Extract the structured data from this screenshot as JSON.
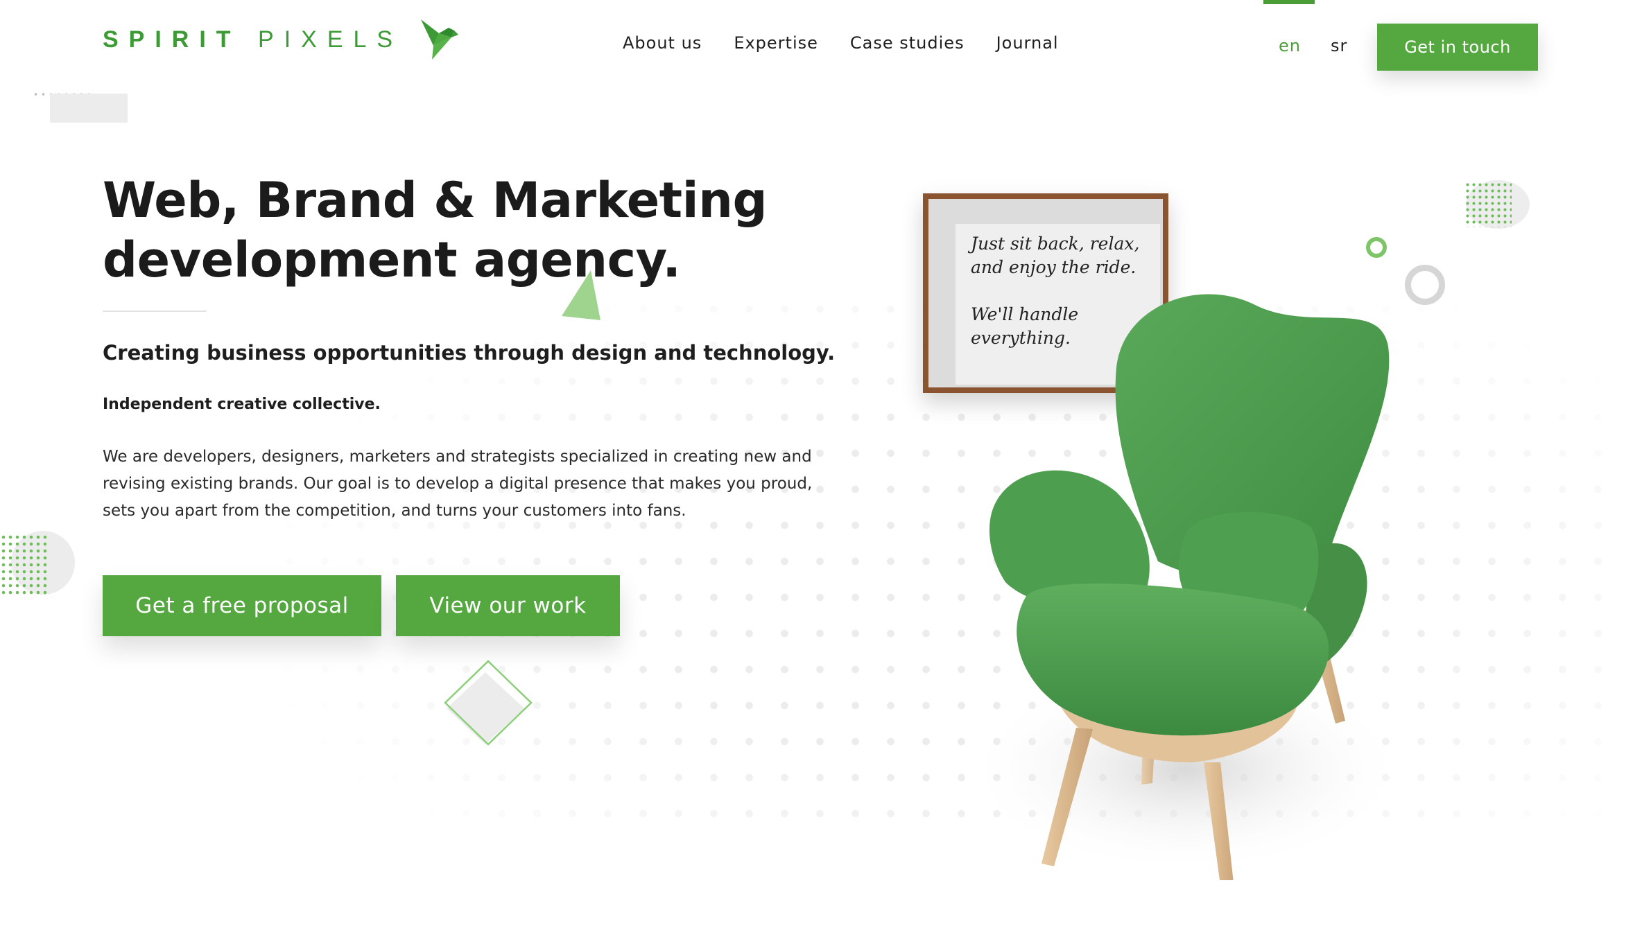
{
  "header": {
    "logo": {
      "word1": "SPIRIT",
      "word2": "PIXELS",
      "icon": "bird-logo-icon",
      "color": "#3d9b35"
    },
    "nav": [
      "About us",
      "Expertise",
      "Case studies",
      "Journal"
    ],
    "languages": {
      "active": "en",
      "other": "sr"
    },
    "cta_label": "Get in touch"
  },
  "hero": {
    "title_line1": "Web, Brand & Marketing",
    "title_line2": "development agency.",
    "subtitle": "Creating business opportunities through design and technology.",
    "tagline": "Independent creative collective.",
    "paragraph": "We are developers, designers, marketers and strategists specialized in creating new and revising existing brands. Our goal is to develop a digital presence that makes you proud, sets you apart from the competition, and turns your customers into fans.",
    "primary_button": "Get a free proposal",
    "secondary_button": "View our work"
  },
  "illustration": {
    "frame_lines": [
      "Just sit back, relax,",
      "and enjoy the ride.",
      "We'll handle",
      "everything."
    ],
    "chair_icon": "green-armchair-icon"
  },
  "colors": {
    "accent": "#54a83f",
    "accent_dark": "#3d9b35",
    "text": "#1b1b1b"
  }
}
